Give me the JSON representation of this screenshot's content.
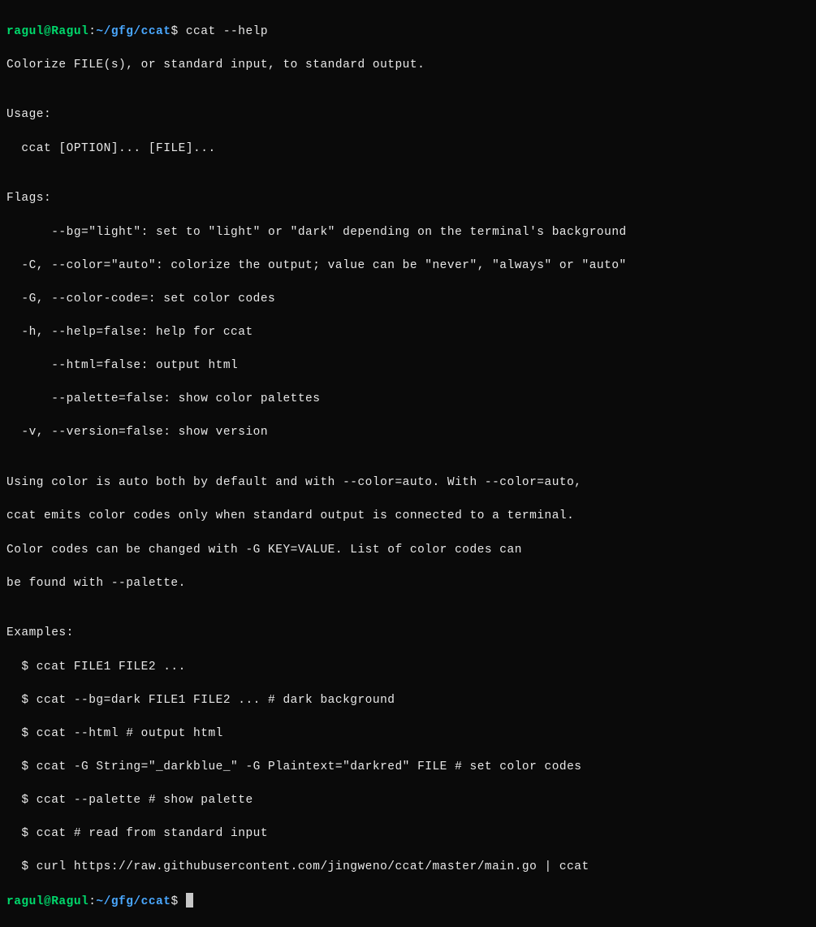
{
  "prompt1": {
    "user": "ragul@Ragul",
    "colon": ":",
    "path": "~/gfg/ccat",
    "dollar": "$ ",
    "command": "ccat --help"
  },
  "output": {
    "l01": "Colorize FILE(s), or standard input, to standard output.",
    "l02": "",
    "l03": "Usage:",
    "l04": "  ccat [OPTION]... [FILE]...",
    "l05": "",
    "l06": "Flags:",
    "l07": "      --bg=\"light\": set to \"light\" or \"dark\" depending on the terminal's background",
    "l08": "  -C, --color=\"auto\": colorize the output; value can be \"never\", \"always\" or \"auto\"",
    "l09": "  -G, --color-code=: set color codes",
    "l10": "  -h, --help=false: help for ccat",
    "l11": "      --html=false: output html",
    "l12": "      --palette=false: show color palettes",
    "l13": "  -v, --version=false: show version",
    "l14": "",
    "l15": "Using color is auto both by default and with --color=auto. With --color=auto,",
    "l16": "ccat emits color codes only when standard output is connected to a terminal.",
    "l17": "Color codes can be changed with -G KEY=VALUE. List of color codes can",
    "l18": "be found with --palette.",
    "l19": "",
    "l20": "Examples:",
    "l21": "  $ ccat FILE1 FILE2 ...",
    "l22": "  $ ccat --bg=dark FILE1 FILE2 ... # dark background",
    "l23": "  $ ccat --html # output html",
    "l24": "  $ ccat -G String=\"_darkblue_\" -G Plaintext=\"darkred\" FILE # set color codes",
    "l25": "  $ ccat --palette # show palette",
    "l26": "  $ ccat # read from standard input",
    "l27": "  $ curl https://raw.githubusercontent.com/jingweno/ccat/master/main.go | ccat"
  },
  "prompt2": {
    "user": "ragul@Ragul",
    "colon": ":",
    "path": "~/gfg/ccat",
    "dollar": "$ "
  }
}
